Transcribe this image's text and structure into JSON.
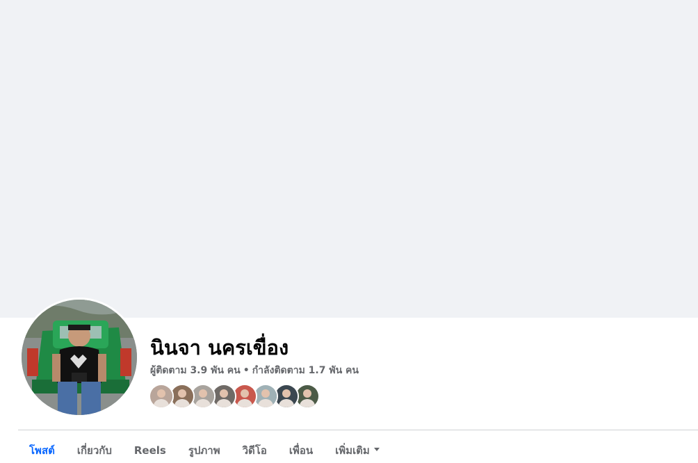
{
  "profile": {
    "name": "นินจา นครเขื่อง",
    "followers_text": "ผู้ติดตาม 3.9 พัน คน",
    "separator": "•",
    "following_text": "กำลังติดตาม 1.7 พัน คน",
    "avatar_icon": "profile-photo"
  },
  "follower_avatars": [
    {
      "name": "follower-avatar-1",
      "color": "#b9a59a"
    },
    {
      "name": "follower-avatar-2",
      "color": "#8a6f5a"
    },
    {
      "name": "follower-avatar-3",
      "color": "#a8a39d"
    },
    {
      "name": "follower-avatar-4",
      "color": "#6f6a66"
    },
    {
      "name": "follower-avatar-5",
      "color": "#c9584d"
    },
    {
      "name": "follower-avatar-6",
      "color": "#9fb1b6"
    },
    {
      "name": "follower-avatar-7",
      "color": "#3b4750"
    },
    {
      "name": "follower-avatar-8",
      "color": "#4c5b47"
    }
  ],
  "tabs": [
    {
      "label": "โพสต์",
      "active": true
    },
    {
      "label": "เกี่ยวกับ",
      "active": false
    },
    {
      "label": "Reels",
      "active": false
    },
    {
      "label": "รูปภาพ",
      "active": false
    },
    {
      "label": "วิดีโอ",
      "active": false
    },
    {
      "label": "เพื่อน",
      "active": false
    },
    {
      "label": "เพิ่มเติม",
      "active": false,
      "dropdown": true
    }
  ],
  "colors": {
    "cover_bg": "#f0f2f5",
    "active_tab": "#0866ff",
    "secondary_text": "#65676b"
  }
}
